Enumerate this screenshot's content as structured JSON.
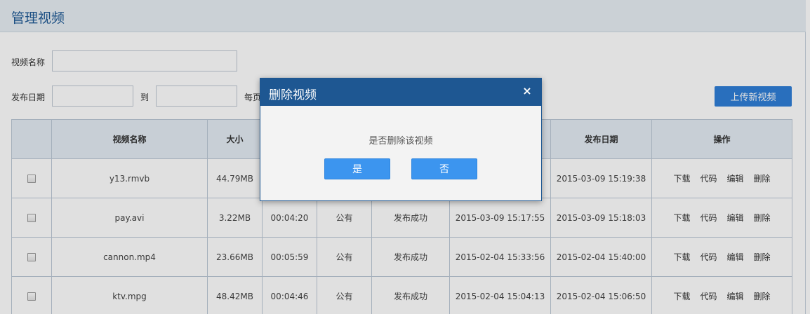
{
  "page": {
    "title": "管理视频"
  },
  "filters": {
    "name_label": "视频名称",
    "date_label": "发布日期",
    "to_label": "到",
    "per_page_label": "每页",
    "name_value": "",
    "date_from": "",
    "date_to": ""
  },
  "toolbar": {
    "upload_label": "上传新视频"
  },
  "table": {
    "headers": [
      "",
      "视频名称",
      "大小",
      "",
      "",
      "",
      "",
      "发布日期",
      "操作"
    ],
    "rows": [
      {
        "name": "y13.rmvb",
        "size": "44.79MB",
        "duration": "",
        "privacy": "",
        "status": "",
        "created": "",
        "published": "2015-03-09 15:19:38"
      },
      {
        "name": "pay.avi",
        "size": "3.22MB",
        "duration": "00:04:20",
        "privacy": "公有",
        "status": "发布成功",
        "created": "2015-03-09 15:17:55",
        "published": "2015-03-09 15:18:03"
      },
      {
        "name": "cannon.mp4",
        "size": "23.66MB",
        "duration": "00:05:59",
        "privacy": "公有",
        "status": "发布成功",
        "created": "2015-02-04 15:33:56",
        "published": "2015-02-04 15:40:00"
      },
      {
        "name": "ktv.mpg",
        "size": "48.42MB",
        "duration": "00:04:46",
        "privacy": "公有",
        "status": "发布成功",
        "created": "2015-02-04 15:04:13",
        "published": "2015-02-04 15:06:50"
      }
    ],
    "actions": {
      "download": "下载",
      "code": "代码",
      "edit": "编辑",
      "delete": "删除"
    }
  },
  "modal": {
    "title": "删除视频",
    "close_glyph": "×",
    "message": "是否删除该视频",
    "yes_label": "是",
    "no_label": "否"
  },
  "colors": {
    "accent": "#1e5792",
    "button": "#3c95ef",
    "title": "#1f5a96"
  }
}
